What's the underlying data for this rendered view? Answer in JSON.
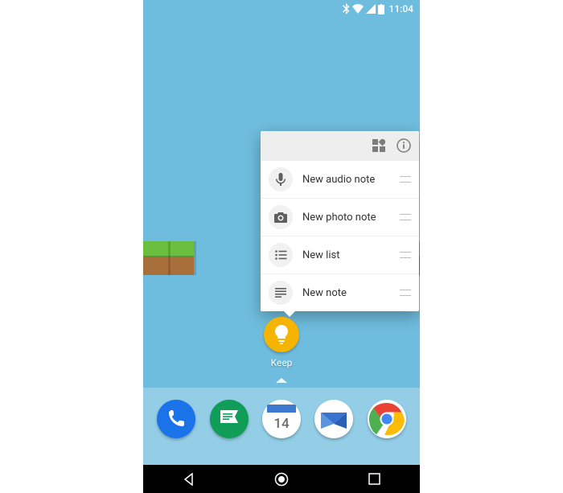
{
  "status": {
    "time": "11:04"
  },
  "popup": {
    "items": [
      {
        "icon": "mic-icon",
        "label": "New audio note"
      },
      {
        "icon": "camera-icon",
        "label": "New photo note"
      },
      {
        "icon": "list-icon",
        "label": "New list"
      },
      {
        "icon": "note-icon",
        "label": "New note"
      }
    ]
  },
  "app": {
    "keep_label": "Keep"
  },
  "dock": {
    "calendar_day": "14",
    "items": [
      "phone",
      "messages",
      "calendar",
      "inbox",
      "chrome"
    ]
  }
}
